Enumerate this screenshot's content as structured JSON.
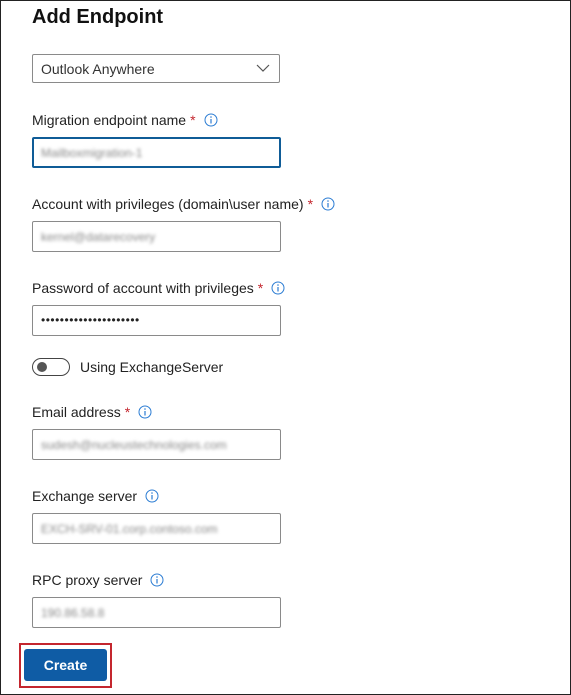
{
  "header": {
    "title": "Add Endpoint"
  },
  "endpoint_type": {
    "selected": "Outlook Anywhere"
  },
  "fields": {
    "migration_name": {
      "label": "Migration endpoint name",
      "required": "*",
      "value": "Mailboxmigration-1"
    },
    "account": {
      "label": "Account with privileges (domain\\user name)",
      "required": "*",
      "value": "kernel@datarecovery"
    },
    "password": {
      "label": "Password of account with privileges",
      "required": "*",
      "value": "•••••••••••••••••••••"
    },
    "email": {
      "label": "Email address",
      "required": "*",
      "value": "sudesh@nucleustechnologies.com"
    },
    "exchange_server": {
      "label": "Exchange server",
      "value": "EXCH-SRV-01.corp.contoso.com"
    },
    "rpc_proxy": {
      "label": "RPC proxy server",
      "value": "190.86.58.8"
    }
  },
  "toggle": {
    "label": "Using ExchangeServer",
    "state": "off"
  },
  "actions": {
    "create_label": "Create"
  },
  "colors": {
    "accent": "#0f5ca5",
    "required": "#c4262e",
    "info_icon": "#2b7cd3",
    "highlight": "#c4262e"
  }
}
